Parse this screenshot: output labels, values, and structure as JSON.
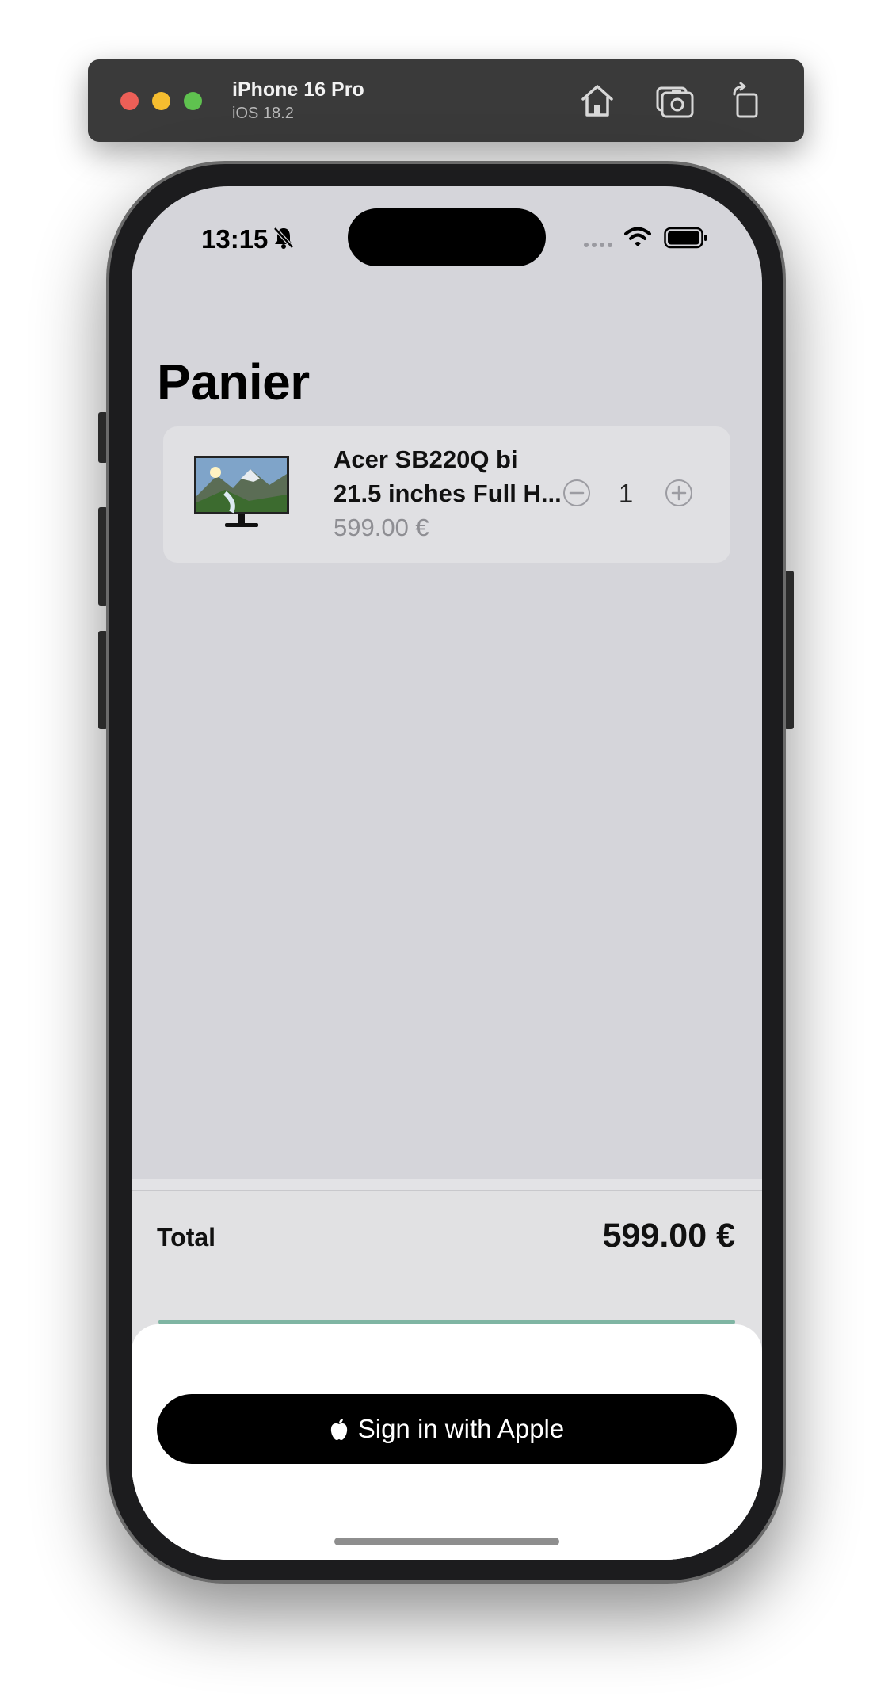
{
  "simulator": {
    "device_name": "iPhone 16 Pro",
    "os_version": "iOS 18.2"
  },
  "status_bar": {
    "time": "13:15"
  },
  "page": {
    "title": "Panier"
  },
  "cart": {
    "items": [
      {
        "name_line1": "Acer SB220Q bi",
        "name_line2": "21.5 inches Full H...",
        "price": "599.00 €",
        "quantity": "1"
      }
    ]
  },
  "summary": {
    "total_label": "Total",
    "total_value": "599.00 €"
  },
  "auth": {
    "apple_button_label": "Sign in with Apple"
  },
  "colors": {
    "screen_bg": "#d5d5da",
    "card_bg": "#e0e0e3",
    "accent_teal": "#7fb5a3",
    "button_black": "#000000"
  }
}
